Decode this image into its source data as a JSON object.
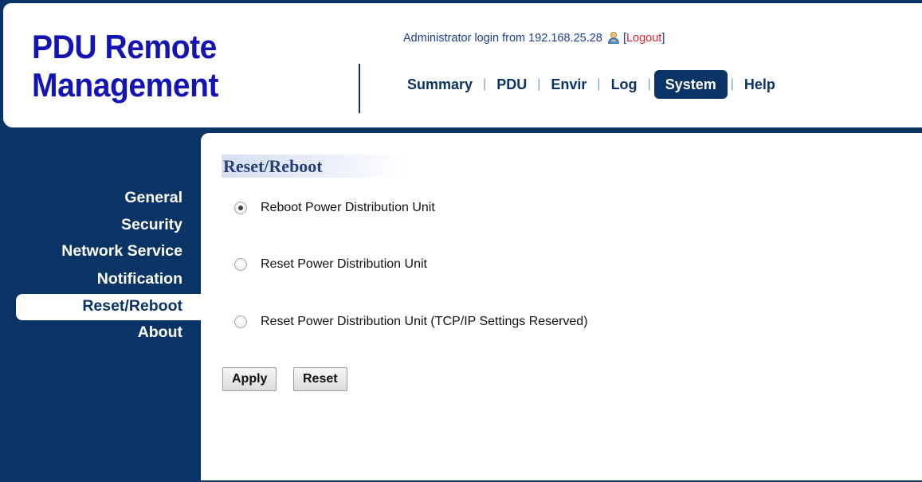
{
  "header": {
    "logo_line1": "PDU Remote",
    "logo_line2": "Management",
    "login_text": "Administrator login from 192.168.25.28",
    "user_icon": "user-icon",
    "logout_open": "[",
    "logout_label": "Logout",
    "logout_close": "]"
  },
  "topnav": {
    "items": [
      "Summary",
      "PDU",
      "Envir",
      "Log",
      "System",
      "Help"
    ],
    "active": "System",
    "separator": "|"
  },
  "sidebar": {
    "items": [
      "General",
      "Security",
      "Network Service",
      "Notification",
      "Reset/Reboot",
      "About"
    ],
    "active": "Reset/Reboot"
  },
  "main": {
    "section_title": "Reset/Reboot",
    "options": [
      {
        "label": "Reboot Power Distribution Unit",
        "checked": true
      },
      {
        "label": "Reset Power Distribution Unit",
        "checked": false
      },
      {
        "label": "Reset Power Distribution Unit (TCP/IP Settings Reserved)",
        "checked": false
      }
    ],
    "apply_label": "Apply",
    "reset_label": "Reset"
  },
  "colors": {
    "navy": "#0b3466",
    "logo_blue": "#1414b4",
    "logout_red": "#e0242b"
  }
}
